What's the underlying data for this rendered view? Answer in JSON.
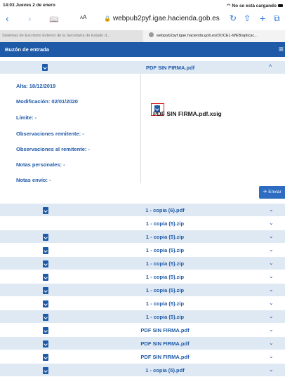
{
  "status_bar": {
    "time_date": "14:03  Jueves 2 de enero",
    "network": "No se está cargando"
  },
  "toolbar": {
    "back": "‹",
    "forward": "›",
    "bookmarks": "📖",
    "aa_small": "A",
    "aa_large": "A",
    "url": "webpub2pyf.igae.hacienda.gob.es",
    "reload": "↻",
    "share": "⇧",
    "new_tab": "+",
    "tabs": "⧉"
  },
  "tabs": [
    {
      "label": "Sistemas de Escritorio Externo de la Secretaría de Estado d..."
    },
    {
      "label": "webpub2pyf.igae.hacienda.gob.es/DOCEL-WEB/aplicac..."
    }
  ],
  "header": {
    "title": "Buzón de entrada",
    "menu": "≡"
  },
  "message": {
    "filename": "PDF SIN FIRMA.pdf",
    "chevron": "^",
    "fields": [
      "Alta: 18/12/2019",
      "Modificación: 02/01/2020",
      "Límite: -",
      "Observaciones remitente: -",
      "Observaciones al remitente: -",
      "Notas personales: -",
      "Notas envío: -"
    ],
    "attachment": "PDF SIN FIRMA.pdf.xsig",
    "send_label": "✈ Enviar"
  },
  "list": [
    {
      "name": "1 - copia (6).pdf",
      "icon": true
    },
    {
      "name": "1 - copia (5).zip",
      "icon": false
    },
    {
      "name": "1 - copia (5).zip",
      "icon": true
    },
    {
      "name": "1 - copia (5).zip",
      "icon": true
    },
    {
      "name": "1 - copia (5).zip",
      "icon": true
    },
    {
      "name": "1 - copia (5).zip",
      "icon": true
    },
    {
      "name": "1 - copia (5).zip",
      "icon": true
    },
    {
      "name": "1 - copia (5).zip",
      "icon": true
    },
    {
      "name": "1 - copia (5).zip",
      "icon": true
    },
    {
      "name": "PDF SIN FIRMA.pdf",
      "icon": true
    },
    {
      "name": "PDF SIN FIRMA.pdf",
      "icon": true
    },
    {
      "name": "PDF SIN FIRMA.pdf",
      "icon": true
    },
    {
      "name": "1 - copia (5).pdf",
      "icon": true
    }
  ],
  "row_chevron": "⌄",
  "colors": {
    "brand": "#1f5aa8",
    "row_alt": "#dfe9f4",
    "highlight": "#e02020"
  }
}
